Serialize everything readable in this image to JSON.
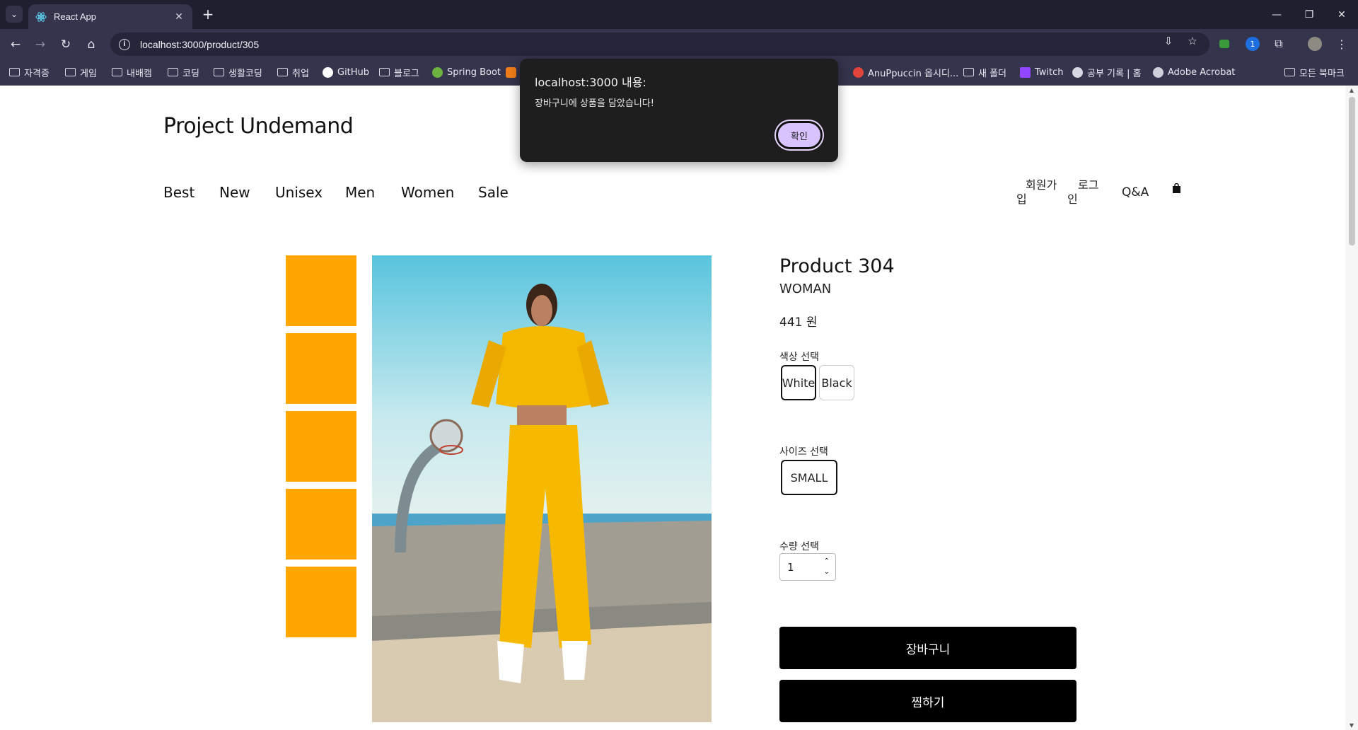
{
  "browser": {
    "tab_title": "React App",
    "url": "localhost:3000/product/305",
    "bookmarks": [
      "자격증",
      "게임",
      "내배캠",
      "코딩",
      "생활코딩",
      "취업",
      "GitHub",
      "블로그",
      "Spring Boot",
      "AnuPpuccin 옵시디...",
      "새 폴더",
      "Twitch",
      "공부 기록 | 홈",
      "Adobe Acrobat"
    ],
    "all_bookmarks_label": "모든 북마크"
  },
  "site": {
    "logo": "Project Undemand",
    "nav": [
      "Best",
      "New",
      "Unisex",
      "Men",
      "Women",
      "Sale"
    ],
    "signup_line1": "회원가",
    "signup_line2": "입",
    "login_line1": "로그",
    "login_line2": "인",
    "qa": "Q&A"
  },
  "product": {
    "title": "Product 304",
    "category": "WOMAN",
    "price": "441 원",
    "color_label": "색상 선택",
    "colors": [
      "White",
      "Black"
    ],
    "selected_color": "White",
    "size_label": "사이즈 선택",
    "sizes": [
      "SMALL"
    ],
    "qty_label": "수량 선택",
    "qty_value": "1",
    "cart_button": "장바구니",
    "wish_button": "찜하기",
    "thumbnail_color": "#ffa600"
  },
  "alert": {
    "title": "localhost:3000 내용:",
    "message": "장바구니에 상품을 담았습니다!",
    "ok": "확인"
  }
}
